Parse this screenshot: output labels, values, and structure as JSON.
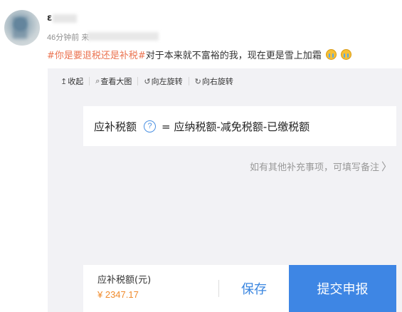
{
  "post": {
    "username": "ɛ",
    "time": "46分钟前",
    "source_prefix": "来",
    "hashtag": "#你是要退税还是补税#",
    "text": "对于本来就不富裕的我，现在更是雪上加霜"
  },
  "toolbar": {
    "items": [
      {
        "icon": "↥",
        "label": "收起"
      },
      {
        "icon": "⌕",
        "label": "查看大图"
      },
      {
        "icon": "↺",
        "label": "向左旋转"
      },
      {
        "icon": "↻",
        "label": "向右旋转"
      }
    ]
  },
  "tax": {
    "label": "应补税额",
    "help_icon": "?",
    "formula": "= 应纳税额-减免税额-已缴税额",
    "remark_placeholder": "如有其他补充事项，可填写备注",
    "chevron": "〉"
  },
  "footer": {
    "due_label": "应补税额(元)",
    "due_amount": "¥ 2347.17",
    "save_label": "保存",
    "submit_label": "提交申报"
  },
  "colors": {
    "hashtag": "#eb7350",
    "accent_blue": "#3e86e4",
    "amount_orange": "#f08b2c"
  }
}
